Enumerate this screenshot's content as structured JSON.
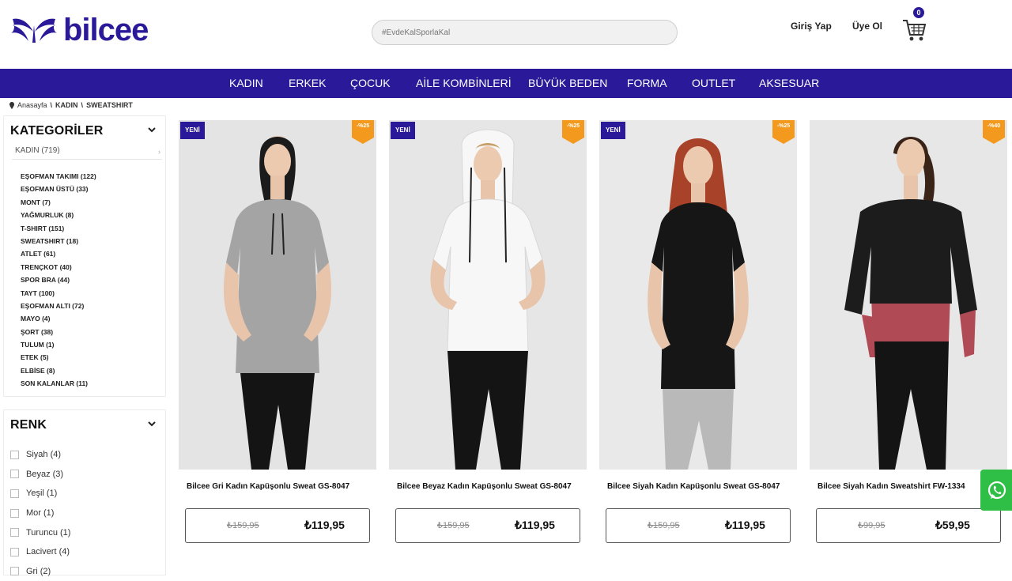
{
  "brand": {
    "name": "bilcee",
    "color": "#2a1a99"
  },
  "header": {
    "search_placeholder": "#EvdeKalSporlaKal",
    "login_label": "Giriş Yap",
    "register_label": "Üye Ol",
    "cart_count": "0",
    "cart_icon": "shopping-cart-icon"
  },
  "nav": {
    "items": [
      "KADIN",
      "ERKEK",
      "ÇOCUK",
      "AİLE KOMBİNLERİ",
      "BÜYÜK BEDEN",
      "FORMA",
      "OUTLET",
      "AKSESUAR"
    ]
  },
  "breadcrumb": {
    "home": "Anasayfa",
    "level1": "KADIN",
    "level2": "SWEATSHIRT",
    "separator": "\\"
  },
  "categories": {
    "title": "KATEGORİLER",
    "main": "KADIN (719)",
    "items": [
      "EŞOFMAN TAKIMI (122)",
      "EŞOFMAN ÜSTÜ (33)",
      "MONT (7)",
      "YAĞMURLUK (8)",
      "T-SHIRT (151)",
      "SWEATSHIRT (18)",
      "ATLET (61)",
      "TRENÇKOT (40)",
      "SPOR BRA (44)",
      "TAYT (100)",
      "EŞOFMAN ALTI (72)",
      "MAYO (4)",
      "ŞORT (38)",
      "TULUM (1)",
      "ETEK (5)",
      "ELBİSE (8)",
      "SON KALANLAR (11)"
    ]
  },
  "colors": {
    "title": "RENK",
    "items": [
      "Siyah (4)",
      "Beyaz (3)",
      "Yeşil (1)",
      "Mor (1)",
      "Turuncu (1)",
      "Lacivert (4)",
      "Gri (2)"
    ]
  },
  "products": [
    {
      "name": "Bilcee Gri Kadın Kapüşonlu Sweat GS-8047",
      "old_price": "₺159,95",
      "new_price": "₺119,95",
      "badge": "YENİ",
      "discount": "-%25",
      "garment_color": "#a4a4a4"
    },
    {
      "name": "Bilcee Beyaz Kadın Kapüşonlu Sweat GS-8047",
      "old_price": "₺159,95",
      "new_price": "₺119,95",
      "badge": "YENİ",
      "discount": "-%25",
      "garment_color": "#f7f7f7"
    },
    {
      "name": "Bilcee Siyah Kadın Kapüşonlu Sweat GS-8047",
      "old_price": "₺159,95",
      "new_price": "₺119,95",
      "badge": "YENİ",
      "discount": "-%25",
      "garment_color": "#161616"
    },
    {
      "name": "Bilcee Siyah Kadın Sweatshirt FW-1334",
      "old_price": "₺99,95",
      "new_price": "₺59,95",
      "badge": "",
      "discount": "-%40",
      "garment_color": "#1c1c1c"
    }
  ],
  "accent_colors": {
    "nav_bg": "#2a1a99",
    "discount_badge": "#f39a1e",
    "whatsapp": "#2fbe46"
  },
  "whatsapp_icon": "whatsapp-icon"
}
